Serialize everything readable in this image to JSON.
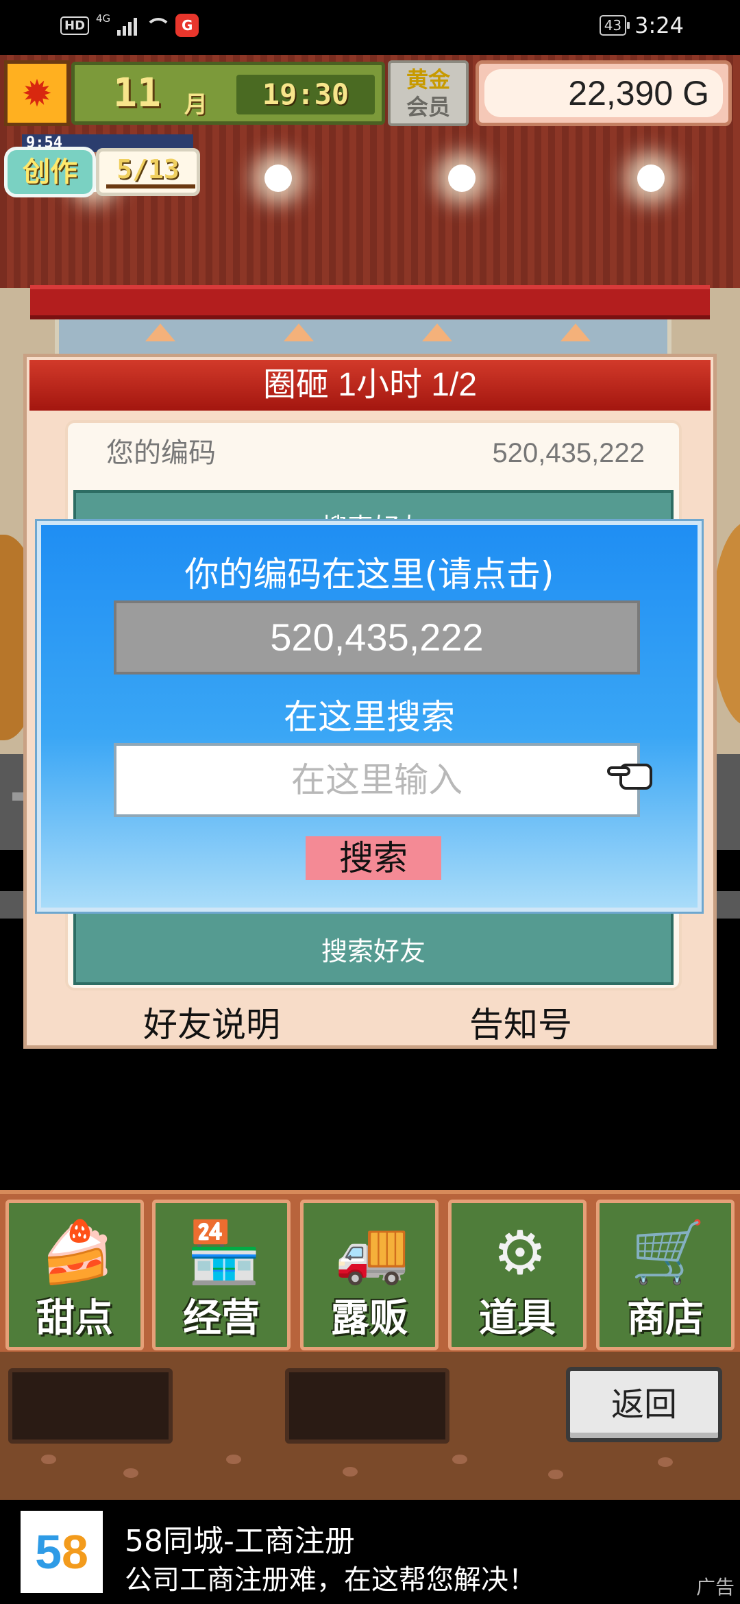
{
  "status_bar": {
    "hd": "HD",
    "network": "4G",
    "app_badge": "G",
    "battery": "43",
    "time": "3:24"
  },
  "hud": {
    "month_num": "11",
    "month_unit": "月",
    "time": "19:30",
    "member_line1": "黄金",
    "member_line2": "会员",
    "money": "22,390 G",
    "create_timer": "9:54",
    "create_label": "创作",
    "create_count": "5/13",
    "leaf_icon": "maple-leaf-icon"
  },
  "panel": {
    "title": "圈砸  1小时 1/2",
    "code_label": "您的编码",
    "code_value": "520,435,222",
    "teal_top_text": "搜索好友",
    "teal_bottom_text": "搜索好友",
    "footer_left": "好友说明",
    "footer_right": "告知号"
  },
  "dialog": {
    "code_prompt": "你的编码在这里(请点击)",
    "code_value": "520,435,222",
    "search_prompt": "在这里搜索",
    "input_placeholder": "在这里输入",
    "search_button": "搜索",
    "pointer_icon": "pointing-hand-icon"
  },
  "menu": {
    "items": [
      {
        "label": "甜点",
        "icon": "cake-icon"
      },
      {
        "label": "经营",
        "icon": "shop-icon"
      },
      {
        "label": "露贩",
        "icon": "food-truck-icon"
      },
      {
        "label": "道具",
        "icon": "items-bag-icon"
      },
      {
        "label": "商店",
        "icon": "shopping-cart-icon"
      }
    ]
  },
  "lower": {
    "back_button": "返回"
  },
  "ad": {
    "logo": "58",
    "title": "58同城-工商注册",
    "subtitle": "公司工商注册难，在这帮您解决！",
    "tag": "广告"
  }
}
